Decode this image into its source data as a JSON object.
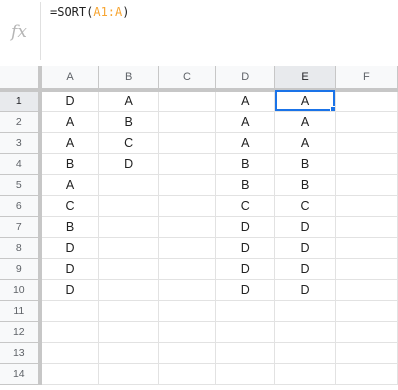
{
  "formula_bar": {
    "fx_label": "fx",
    "formula_prefix": "=SORT(",
    "formula_range": "A1:A",
    "formula_suffix": ")"
  },
  "columns": [
    "A",
    "B",
    "C",
    "D",
    "E",
    "F"
  ],
  "selected_column": "E",
  "selected_row": "1",
  "rows": [
    {
      "num": "1",
      "cells": [
        "D",
        "A",
        "",
        "A",
        "A",
        ""
      ]
    },
    {
      "num": "2",
      "cells": [
        "A",
        "B",
        "",
        "A",
        "A",
        ""
      ]
    },
    {
      "num": "3",
      "cells": [
        "A",
        "C",
        "",
        "A",
        "A",
        ""
      ]
    },
    {
      "num": "4",
      "cells": [
        "B",
        "D",
        "",
        "B",
        "B",
        ""
      ]
    },
    {
      "num": "5",
      "cells": [
        "A",
        "",
        "",
        "B",
        "B",
        ""
      ]
    },
    {
      "num": "6",
      "cells": [
        "C",
        "",
        "",
        "C",
        "C",
        ""
      ]
    },
    {
      "num": "7",
      "cells": [
        "B",
        "",
        "",
        "D",
        "D",
        ""
      ]
    },
    {
      "num": "8",
      "cells": [
        "D",
        "",
        "",
        "D",
        "D",
        ""
      ]
    },
    {
      "num": "9",
      "cells": [
        "D",
        "",
        "",
        "D",
        "D",
        ""
      ]
    },
    {
      "num": "10",
      "cells": [
        "D",
        "",
        "",
        "D",
        "D",
        ""
      ]
    },
    {
      "num": "11",
      "cells": [
        "",
        "",
        "",
        "",
        "",
        ""
      ]
    },
    {
      "num": "12",
      "cells": [
        "",
        "",
        "",
        "",
        "",
        ""
      ]
    },
    {
      "num": "13",
      "cells": [
        "",
        "",
        "",
        "",
        "",
        ""
      ]
    },
    {
      "num": "14",
      "cells": [
        "",
        "",
        "",
        "",
        "",
        ""
      ]
    }
  ],
  "colors": {
    "accent": "#1a73e8",
    "range_ref": "#f7a532",
    "header_bg": "#f8f9fa",
    "selected_header_bg": "#e8eaed"
  }
}
